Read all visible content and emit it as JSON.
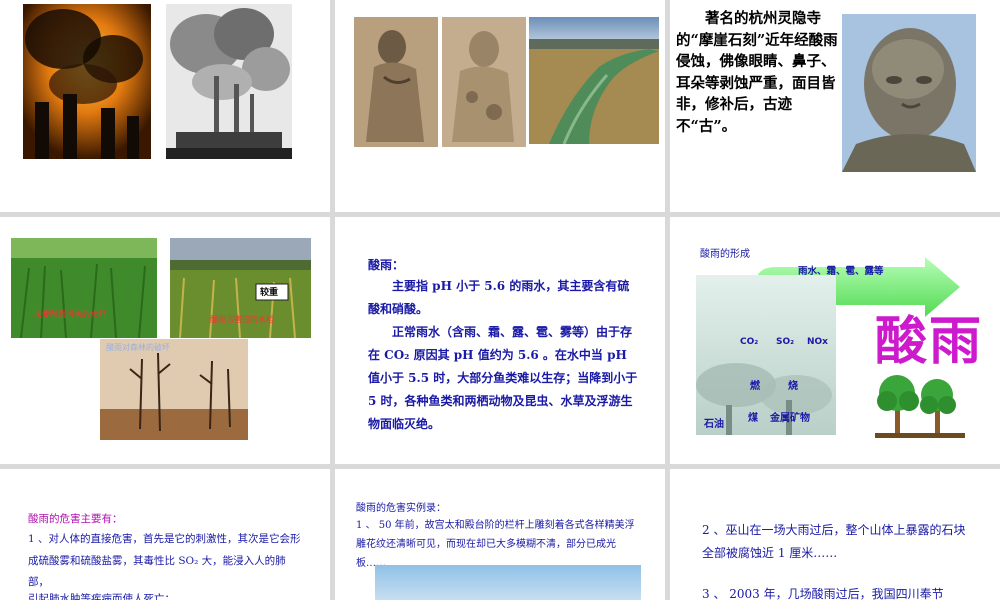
{
  "slide3": {
    "text": "著名的杭州灵隐寺的“摩崖石刻”近年经酸雨侵蚀，佛像眼睛、鼻子、耳朵等剥蚀严重，面目皆非，修补后，古迹不“古”。"
  },
  "slide4": {
    "caption_rice": "未受酸雨污害的水稻",
    "caption_sign": "较重",
    "caption_damaged": "酸雨污害过的水稻",
    "caption_forest": "酸雨对森林的破坏"
  },
  "slide5": {
    "heading": "酸雨：",
    "p1": "主要指 pH 小于 5.6 的雨水，其主要含有硫酸和硝酸。",
    "p2": "正常雨水（含雨、霜、露、雹、雾等）由于存在 CO₂ 原因其 pH 值约为 5.6 。在水中当 pH 值小于 5.5 时，大部分鱼类难以生存；当降到小于 5 时，各种鱼类和两栖动物及昆虫、水草及浮游生物面临灭绝。"
  },
  "slide6": {
    "title": "酸雨的形成",
    "arrow_label": "雨水、霜、雹、露等",
    "big_title": "酸雨",
    "gas1": "CO₂",
    "gas2": "SO₂",
    "gas3": "NOx",
    "burn1": "燃",
    "burn2": "烧",
    "fuel1": "石油",
    "fuel2": "煤",
    "fuel3": "金属矿物"
  },
  "slide7": {
    "heading": "酸雨的危害主要有：",
    "p1": "1 、对人体的直接危害，首先是它的刺激性，其次是它会形成硫酸雾和硫酸盐雾，其毒性比 SO₂ 大，能浸入人的肺部，",
    "p2": "引起肺水肿等疾病而使人死亡；"
  },
  "slide8": {
    "heading": "酸雨的危害实例录：",
    "p1": "1 、 50 年前，故宫太和殿台阶的栏杆上雕刻着各式各样精美浮雕花纹还清晰可见，而现在却已大多模糊不清，部分已成光板……"
  },
  "slide9": {
    "p1": "2 、巫山在一场大雨过后，整个山体上暴露的石块全部被腐蚀近 1 厘米……",
    "p2": "3 、 2003 年，几场酸雨过后，我国四川奉节"
  }
}
